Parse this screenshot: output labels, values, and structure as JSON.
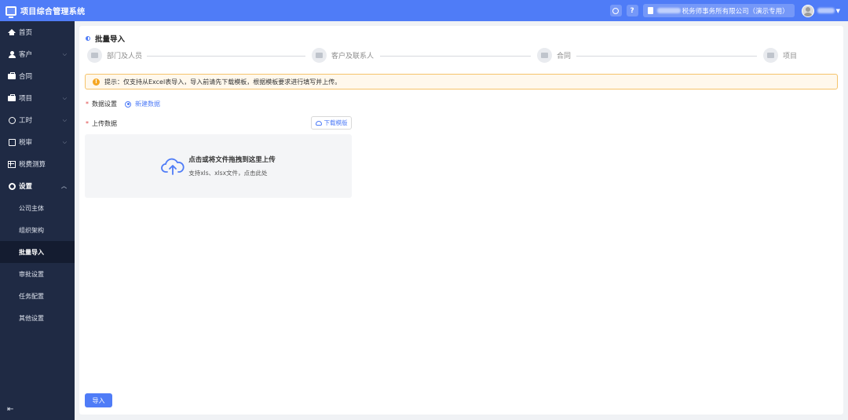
{
  "app": {
    "title": "项目综合管理系统"
  },
  "header": {
    "company": "税务师事务所有限公司（演示专用）",
    "help_icon": "?"
  },
  "sidebar": {
    "items": [
      {
        "label": "首页",
        "icon": "home-icon"
      },
      {
        "label": "客户",
        "icon": "user-icon"
      },
      {
        "label": "合同",
        "icon": "briefcase-icon"
      },
      {
        "label": "项目",
        "icon": "folder-icon"
      },
      {
        "label": "工时",
        "icon": "clock-icon"
      },
      {
        "label": "税审",
        "icon": "edit-icon"
      },
      {
        "label": "税费测算",
        "icon": "calculator-icon"
      },
      {
        "label": "设置",
        "icon": "gear-icon"
      }
    ],
    "settings_sub": [
      {
        "label": "公司主体"
      },
      {
        "label": "组织架构"
      },
      {
        "label": "批量导入"
      },
      {
        "label": "审批设置"
      },
      {
        "label": "任务配置"
      },
      {
        "label": "其他设置"
      }
    ],
    "collapse_icon": "⇤"
  },
  "page": {
    "title": "批量导入",
    "steps": [
      {
        "label": "部门及人员"
      },
      {
        "label": "客户及联系人"
      },
      {
        "label": "合同"
      },
      {
        "label": "项目"
      }
    ],
    "alert": "提示：仅支持从Excel表导入，导入前请先下载模板，根据模板要求进行填写并上传。",
    "data_setting_label": "数据设置",
    "data_setting_option": "新建数据",
    "upload_label": "上传数据",
    "download_template": "下载模版",
    "dropzone_title": "点击或将文件拖拽到这里上传",
    "dropzone_hint": "支持xls、xlsx文件，点击此处",
    "import_button": "导入"
  },
  "colors": {
    "primary": "#4f7cf7",
    "sidebar_bg": "#1f2a44",
    "warning": "#f5a623"
  }
}
